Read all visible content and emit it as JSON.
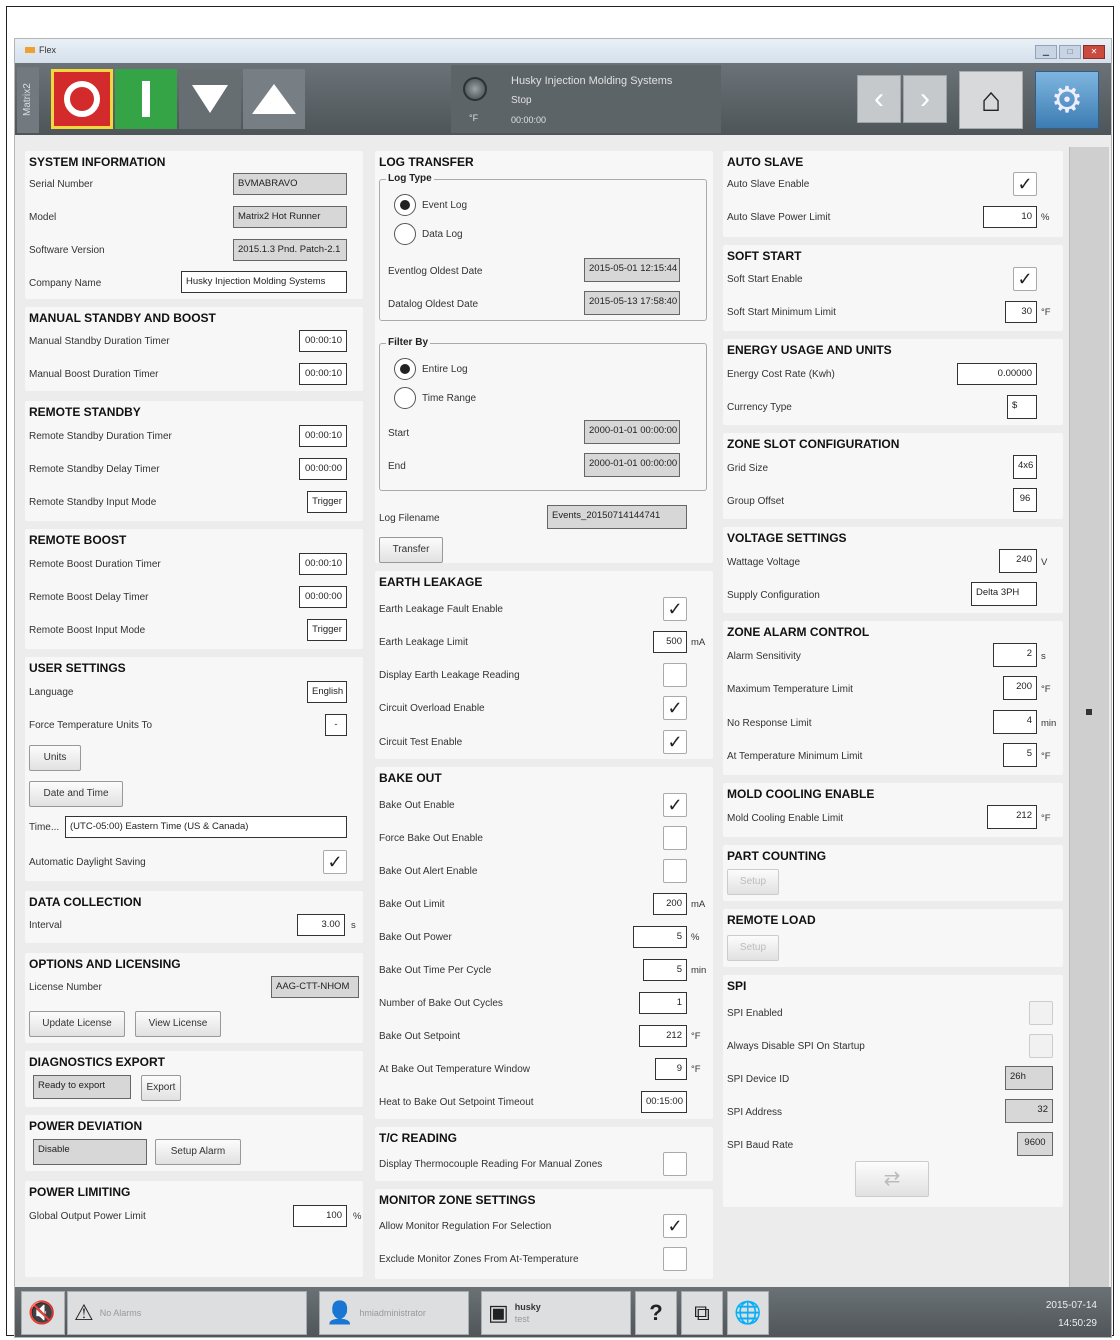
{
  "window": {
    "title": "Flex"
  },
  "header": {
    "vertical_label": "Matrix2",
    "status_line1": "Husky Injection Molding Systems",
    "status_line2": "Stop",
    "status_line3": "00:00:00",
    "temp_unit": "°F"
  },
  "sys": {
    "title": "SYSTEM INFORMATION",
    "serial_label": "Serial Number",
    "serial": "BVMABRAVO",
    "model_label": "Model",
    "model": "Matrix2 Hot Runner",
    "sw_label": "Software Version",
    "sw": "2015.1.3 Pnd. Patch-2.1",
    "company_label": "Company Name",
    "company": "Husky Injection Molding Systems"
  },
  "msb": {
    "title": "MANUAL STANDBY AND BOOST",
    "standby_label": "Manual Standby Duration Timer",
    "standby": "00:00:10",
    "boost_label": "Manual Boost Duration Timer",
    "boost": "00:00:10"
  },
  "rs": {
    "title": "REMOTE STANDBY",
    "dur_label": "Remote Standby Duration Timer",
    "dur": "00:00:10",
    "delay_label": "Remote Standby Delay Timer",
    "delay": "00:00:00",
    "mode_label": "Remote Standby Input Mode",
    "mode": "Trigger"
  },
  "rb": {
    "title": "REMOTE BOOST",
    "dur_label": "Remote Boost Duration Timer",
    "dur": "00:00:10",
    "delay_label": "Remote Boost Delay Timer",
    "delay": "00:00:00",
    "mode_label": "Remote Boost Input Mode",
    "mode": "Trigger"
  },
  "us": {
    "title": "USER SETTINGS",
    "lang_label": "Language",
    "lang": "English",
    "force_label": "Force Temperature Units To",
    "force": "-",
    "units_btn": "Units",
    "datetime_btn": "Date and Time",
    "time_label": "Time...",
    "timezone": "(UTC-05:00) Eastern Time (US & Canada)",
    "dst_label": "Automatic Daylight Saving"
  },
  "dc": {
    "title": "DATA COLLECTION",
    "interval_label": "Interval",
    "interval": "3.00",
    "unit": "s"
  },
  "ol": {
    "title": "OPTIONS AND LICENSING",
    "license_label": "License Number",
    "license": "AAG-CTT-NHOM",
    "update_btn": "Update License",
    "view_btn": "View License"
  },
  "de": {
    "title": "DIAGNOSTICS EXPORT",
    "status": "Ready to export",
    "export_btn": "Export"
  },
  "pd": {
    "title": "POWER DEVIATION",
    "value": "Disable",
    "setup_btn": "Setup Alarm"
  },
  "pl": {
    "title": "POWER LIMITING",
    "limit_label": "Global Output Power Limit",
    "limit": "100",
    "unit": "%"
  },
  "lt": {
    "title": "LOG TRANSFER",
    "logtype": "Log Type",
    "event": "Event Log",
    "data": "Data Log",
    "event_oldest_label": "Eventlog Oldest Date",
    "event_oldest": "2015-05-01 12:15:44",
    "data_oldest_label": "Datalog Oldest Date",
    "data_oldest": "2015-05-13 17:58:40",
    "filter": "Filter By",
    "entire": "Entire Log",
    "range": "Time Range",
    "start_label": "Start",
    "start": "2000-01-01 00:00:00",
    "end_label": "End",
    "end": "2000-01-01 00:00:00",
    "filename_label": "Log Filename",
    "filename": "Events_20150714144741",
    "transfer_btn": "Transfer"
  },
  "el": {
    "title": "EARTH LEAKAGE",
    "fault_label": "Earth Leakage Fault Enable",
    "limit_label": "Earth Leakage Limit",
    "limit": "500",
    "limit_unit": "mA",
    "display_label": "Display Earth Leakage Reading",
    "overload_label": "Circuit Overload Enable",
    "test_label": "Circuit Test Enable"
  },
  "bo": {
    "title": "BAKE OUT",
    "enable_label": "Bake Out Enable",
    "force_label": "Force Bake Out Enable",
    "alert_label": "Bake Out Alert Enable",
    "limit_label": "Bake Out Limit",
    "limit": "200",
    "limit_unit": "mA",
    "power_label": "Bake Out Power",
    "power": "5",
    "power_unit": "%",
    "time_label": "Bake Out Time Per Cycle",
    "time": "5",
    "time_unit": "min",
    "cycles_label": "Number of Bake Out Cycles",
    "cycles": "1",
    "setpoint_label": "Bake Out Setpoint",
    "setpoint": "212",
    "setpoint_unit": "°F",
    "window_label": "At Bake Out Temperature Window",
    "window": "9",
    "window_unit": "°F",
    "timeout_label": "Heat to Bake Out Setpoint Timeout",
    "timeout": "00:15:00"
  },
  "tc": {
    "title": "T/C READING",
    "display_label": "Display Thermocouple Reading For Manual Zones"
  },
  "mz": {
    "title": "MONITOR ZONE SETTINGS",
    "allow_label": "Allow Monitor Regulation For Selection",
    "exclude_label": "Exclude Monitor Zones From At-Temperature"
  },
  "as": {
    "title": "AUTO SLAVE",
    "enable_label": "Auto Slave Enable",
    "limit_label": "Auto Slave Power Limit",
    "limit": "10",
    "unit": "%"
  },
  "ss": {
    "title": "SOFT START",
    "enable_label": "Soft Start Enable",
    "min_label": "Soft Start Minimum Limit",
    "min": "30",
    "unit": "°F"
  },
  "eu": {
    "title": "ENERGY USAGE AND UNITS",
    "rate_label": "Energy Cost Rate (Kwh)",
    "rate": "0.00000",
    "currency_label": "Currency Type",
    "currency": "$"
  },
  "zs": {
    "title": "ZONE SLOT CONFIGURATION",
    "grid_label": "Grid Size",
    "grid": "4x6",
    "offset_label": "Group Offset",
    "offset": "96"
  },
  "vs": {
    "title": "VOLTAGE SETTINGS",
    "watt_label": "Wattage Voltage",
    "watt": "240",
    "watt_unit": "V",
    "supply_label": "Supply Configuration",
    "supply": "Delta 3PH"
  },
  "za": {
    "title": "ZONE ALARM CONTROL",
    "sens_label": "Alarm Sensitivity",
    "sens": "2",
    "sens_unit": "s",
    "max_label": "Maximum Temperature Limit",
    "max": "200",
    "max_unit": "°F",
    "nores_label": "No Response Limit",
    "nores": "4",
    "nores_unit": "min",
    "attemp_label": "At Temperature Minimum Limit",
    "attemp": "5",
    "attemp_unit": "°F"
  },
  "mc": {
    "title": "MOLD COOLING ENABLE",
    "limit_label": "Mold Cooling Enable Limit",
    "limit": "212",
    "unit": "°F"
  },
  "pc": {
    "title": "PART COUNTING",
    "setup_btn": "Setup"
  },
  "rl": {
    "title": "REMOTE LOAD",
    "setup_btn": "Setup"
  },
  "spi": {
    "title": "SPI",
    "enabled_label": "SPI Enabled",
    "disable_label": "Always Disable SPI On Startup",
    "device_label": "SPI Device ID",
    "device": "26h",
    "address_label": "SPI Address",
    "address": "32",
    "baud_label": "SPI Baud Rate",
    "baud": "9600"
  },
  "bottom": {
    "alarms": "No Alarms",
    "user": "hmiadministrator",
    "mold_line1": "husky",
    "mold_line2": "test",
    "date": "2015-07-14",
    "time": "14:50:29"
  }
}
